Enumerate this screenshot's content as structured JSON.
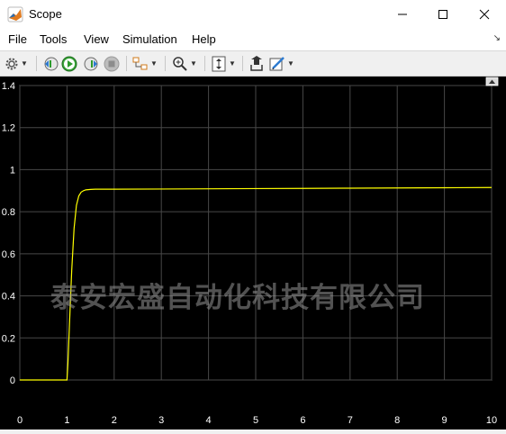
{
  "window": {
    "title": "Scope"
  },
  "menu": [
    "File",
    "Tools",
    "View",
    "Simulation",
    "Help"
  ],
  "toolbar": {
    "buttons": [
      {
        "name": "configuration-properties-icon",
        "has_dropdown": true
      },
      {
        "name": "step-back-icon",
        "has_dropdown": false
      },
      {
        "name": "run-icon",
        "has_dropdown": false
      },
      {
        "name": "step-forward-icon",
        "has_dropdown": false
      },
      {
        "name": "stop-icon",
        "has_dropdown": false
      },
      {
        "name": "highlight-block-icon",
        "has_dropdown": true
      },
      {
        "name": "zoom-in-icon",
        "has_dropdown": true
      },
      {
        "name": "scale-y-axis-icon",
        "has_dropdown": true
      },
      {
        "name": "restore-layout-icon",
        "has_dropdown": false
      },
      {
        "name": "style-brush-icon",
        "has_dropdown": true
      }
    ]
  },
  "colors": {
    "background": "#000000",
    "grid": "#484848",
    "signal": "#ffff00",
    "tick_text": "#ffffff"
  },
  "watermark": "泰安宏盛自动化科技有限公司",
  "chart_data": {
    "type": "line",
    "xlim": [
      0,
      10
    ],
    "ylim": [
      0,
      1.4
    ],
    "x_ticks": [
      "0",
      "1",
      "2",
      "3",
      "4",
      "5",
      "6",
      "7",
      "8",
      "9",
      "10"
    ],
    "y_ticks": [
      "0",
      "0.2",
      "0.4",
      "0.6",
      "0.8",
      "1",
      "1.2",
      "1.4"
    ],
    "grid": true,
    "series": [
      {
        "color": "#ffff00",
        "x": [
          0,
          1.0,
          1.02,
          1.05,
          1.1,
          1.15,
          1.2,
          1.25,
          1.3,
          1.35,
          1.4,
          1.5,
          1.6,
          2,
          3,
          4,
          5,
          6,
          7,
          8,
          9,
          10
        ],
        "y": [
          0,
          0,
          0.08,
          0.25,
          0.52,
          0.72,
          0.83,
          0.875,
          0.893,
          0.9,
          0.904,
          0.906,
          0.907,
          0.907,
          0.908,
          0.909,
          0.91,
          0.911,
          0.912,
          0.913,
          0.914,
          0.915
        ]
      }
    ]
  }
}
